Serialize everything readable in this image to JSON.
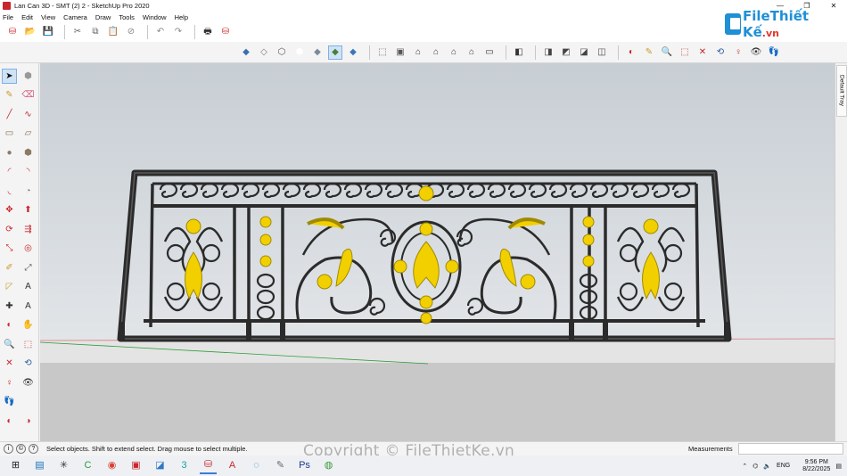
{
  "window": {
    "title": "Lan Can 3D - SMT (2) 2 - SketchUp Pro 2020",
    "min": "—",
    "max": "❐",
    "close": "✕"
  },
  "menu": [
    "File",
    "Edit",
    "View",
    "Camera",
    "Draw",
    "Tools",
    "Window",
    "Help"
  ],
  "toolbar1": [
    {
      "name": "get-models-icon",
      "glyph": "⛁",
      "color": "#c8262c"
    },
    {
      "name": "open-icon",
      "glyph": "📂",
      "color": "#c99a2e"
    },
    {
      "name": "save-icon",
      "glyph": "💾",
      "color": "#2c5d9b"
    },
    {
      "name": "cut-icon",
      "glyph": "✂",
      "color": "#666"
    },
    {
      "name": "copy-icon",
      "glyph": "⧉",
      "color": "#666"
    },
    {
      "name": "paste-icon",
      "glyph": "📋",
      "color": "#666"
    },
    {
      "name": "erase-icon",
      "glyph": "⊘",
      "color": "#888"
    },
    {
      "name": "undo-icon",
      "glyph": "↶",
      "color": "#888"
    },
    {
      "name": "redo-icon",
      "glyph": "↷",
      "color": "#888"
    },
    {
      "name": "print-icon",
      "glyph": "🖶",
      "color": "#333"
    },
    {
      "name": "extension-warehouse-icon",
      "glyph": "⛁",
      "color": "#c8262c"
    }
  ],
  "toolbar2": [
    {
      "name": "xray-icon",
      "glyph": "◆",
      "color": "#3a6fb0"
    },
    {
      "name": "back-edges-icon",
      "glyph": "◇",
      "color": "#777"
    },
    {
      "name": "wireframe-icon",
      "glyph": "⬡",
      "color": "#555"
    },
    {
      "name": "hidden-line-icon",
      "glyph": "⬢",
      "color": "#fff"
    },
    {
      "name": "shaded-icon",
      "glyph": "◆",
      "color": "#7a8a9a"
    },
    {
      "name": "shaded-textures-icon",
      "glyph": "◆",
      "color": "#4a7f3a",
      "active": true
    },
    {
      "name": "monochrome-icon",
      "glyph": "◆",
      "color": "#3b77b8"
    },
    {
      "name": "iso-view-icon",
      "glyph": "⬚",
      "color": "#555"
    },
    {
      "name": "top-view-icon",
      "glyph": "▣",
      "color": "#555"
    },
    {
      "name": "front-view-icon",
      "glyph": "⌂",
      "color": "#333"
    },
    {
      "name": "right-view-icon",
      "glyph": "⌂",
      "color": "#333"
    },
    {
      "name": "back-view-icon",
      "glyph": "⌂",
      "color": "#333"
    },
    {
      "name": "left-view-icon",
      "glyph": "⌂",
      "color": "#333"
    },
    {
      "name": "bottom-view-icon",
      "glyph": "▭",
      "color": "#333"
    },
    {
      "name": "camera-views-icon",
      "glyph": "◧",
      "color": "#333"
    },
    {
      "name": "style-1-icon",
      "glyph": "◨",
      "color": "#444"
    },
    {
      "name": "style-2-icon",
      "glyph": "◩",
      "color": "#444"
    },
    {
      "name": "style-3-icon",
      "glyph": "◪",
      "color": "#444"
    },
    {
      "name": "style-4-icon",
      "glyph": "◫",
      "color": "#444"
    },
    {
      "name": "section-plane-icon",
      "glyph": "◐",
      "color": "#c8262c"
    },
    {
      "name": "paint-bucket-icon",
      "glyph": "✎",
      "color": "#c99a2e"
    },
    {
      "name": "zoom-icon",
      "glyph": "🔍",
      "color": "#2c5d9b"
    },
    {
      "name": "zoom-window-icon",
      "glyph": "⬚",
      "color": "#c8262c"
    },
    {
      "name": "zoom-extents-icon",
      "glyph": "✕",
      "color": "#c8262c"
    },
    {
      "name": "previous-view-icon",
      "glyph": "⟲",
      "color": "#2c5d9b"
    },
    {
      "name": "position-camera-icon",
      "glyph": "♀",
      "color": "#c8262c"
    },
    {
      "name": "look-around-icon",
      "glyph": "👁",
      "color": "#333"
    },
    {
      "name": "walk-icon",
      "glyph": "👣",
      "color": "#333"
    }
  ],
  "left_tools": [
    [
      {
        "name": "select-icon",
        "glyph": "➤",
        "color": "#111",
        "active": true
      },
      {
        "name": "make-component-icon",
        "glyph": "⬢",
        "color": "#999"
      }
    ],
    [
      {
        "name": "paint-bucket-tool-icon",
        "glyph": "✎",
        "color": "#c99a2e"
      },
      {
        "name": "eraser-icon",
        "glyph": "⌫",
        "color": "#d8567a"
      }
    ],
    [
      {
        "name": "line-icon",
        "glyph": "╱",
        "color": "#c8262c"
      },
      {
        "name": "freehand-icon",
        "glyph": "∿",
        "color": "#c8262c"
      }
    ],
    [
      {
        "name": "rectangle-icon",
        "glyph": "▭",
        "color": "#8c6a4a"
      },
      {
        "name": "rotated-rectangle-icon",
        "glyph": "▱",
        "color": "#8c6a4a"
      }
    ],
    [
      {
        "name": "circle-icon",
        "glyph": "●",
        "color": "#8c7a66"
      },
      {
        "name": "polygon-icon",
        "glyph": "⬢",
        "color": "#8c7a66"
      }
    ],
    [
      {
        "name": "arc-icon",
        "glyph": "◜",
        "color": "#c8262c"
      },
      {
        "name": "two-point-arc-icon",
        "glyph": "◝",
        "color": "#c8262c"
      }
    ],
    [
      {
        "name": "three-point-arc-icon",
        "glyph": "◟",
        "color": "#c8262c"
      },
      {
        "name": "pie-icon",
        "glyph": "◔",
        "color": "#8c7a66"
      }
    ],
    [
      {
        "name": "move-icon",
        "glyph": "✥",
        "color": "#c8262c"
      },
      {
        "name": "push-pull-icon",
        "glyph": "⬆",
        "color": "#c8262c"
      }
    ],
    [
      {
        "name": "rotate-icon",
        "glyph": "⟳",
        "color": "#c8262c"
      },
      {
        "name": "follow-me-icon",
        "glyph": "⇶",
        "color": "#c8262c"
      }
    ],
    [
      {
        "name": "scale-icon",
        "glyph": "⤡",
        "color": "#c8262c"
      },
      {
        "name": "offset-icon",
        "glyph": "◎",
        "color": "#c8262c"
      }
    ],
    [
      {
        "name": "tape-measure-icon",
        "glyph": "✐",
        "color": "#c99a2e"
      },
      {
        "name": "dimension-icon",
        "glyph": "⤢",
        "color": "#555"
      }
    ],
    [
      {
        "name": "protractor-icon",
        "glyph": "◸",
        "color": "#c99a2e"
      },
      {
        "name": "text-icon",
        "glyph": "A",
        "color": "#333"
      }
    ],
    [
      {
        "name": "axes-icon",
        "glyph": "✚",
        "color": "#333"
      },
      {
        "name": "3d-text-icon",
        "glyph": "A",
        "color": "#333"
      }
    ],
    [
      {
        "name": "orbit-icon",
        "glyph": "◐",
        "color": "#c8262c"
      },
      {
        "name": "pan-icon",
        "glyph": "✋",
        "color": "#c99a2e"
      }
    ],
    [
      {
        "name": "zoom-tool-icon",
        "glyph": "🔍",
        "color": "#2c5d9b"
      },
      {
        "name": "zoom-window-tool-icon",
        "glyph": "⬚",
        "color": "#c8262c"
      }
    ],
    [
      {
        "name": "zoom-extents-tool-icon",
        "glyph": "✕",
        "color": "#c8262c"
      },
      {
        "name": "previous-tool-icon",
        "glyph": "⟲",
        "color": "#2c5d9b"
      }
    ],
    [
      {
        "name": "position-camera-tool-icon",
        "glyph": "♀",
        "color": "#c8262c"
      },
      {
        "name": "look-around-tool-icon",
        "glyph": "👁",
        "color": "#333"
      }
    ],
    [
      {
        "name": "walk-tool-icon",
        "glyph": "👣",
        "color": "#333"
      },
      {
        "name": "",
        "glyph": "",
        "color": "#333"
      }
    ],
    [
      {
        "name": "section-plane-tool-icon",
        "glyph": "◐",
        "color": "#c8262c"
      },
      {
        "name": "display-section-icon",
        "glyph": "◑",
        "color": "#c8262c"
      }
    ]
  ],
  "viewport": {
    "sky_top": "#c9cfd5",
    "sky_bottom": "#dee2e6",
    "ground": "#c8c8c8",
    "ground_line": "#bfbfbf",
    "frame_color": "#2b2b2b",
    "frame_light": "#5a5a5a",
    "gold": "#f2d000",
    "gold_dark": "#a08a00"
  },
  "tray": {
    "tab": "Default Tray"
  },
  "status": {
    "hint": "Select objects. Shift to extend select. Drag mouse to select multiple.",
    "measurements_label": "Measurements",
    "measurements_value": ""
  },
  "watermark": "Copyright © FileThietKe.vn",
  "logo": {
    "text_main": "File",
    "text_accent": "Thiết Kế",
    "suffix": ".vn"
  },
  "taskbar": {
    "apps": [
      {
        "name": "windows-start-icon",
        "glyph": "⊞",
        "color": "#222"
      },
      {
        "name": "file-manager-icon",
        "glyph": "▤",
        "color": "#1f6fb5"
      },
      {
        "name": "network-app-icon",
        "glyph": "✳",
        "color": "#333"
      },
      {
        "name": "camtasia-icon",
        "glyph": "C",
        "color": "#2e9b3a"
      },
      {
        "name": "chrome-icon",
        "glyph": "◉",
        "color": "#d9432f"
      },
      {
        "name": "autocad-icon",
        "glyph": "▣",
        "color": "#c8262c"
      },
      {
        "name": "app-icon-6",
        "glyph": "◪",
        "color": "#2f78c4"
      },
      {
        "name": "3dsmax-icon",
        "glyph": "3",
        "color": "#1aa39a"
      },
      {
        "name": "sketchup-icon",
        "glyph": "⛁",
        "color": "#c8262c",
        "active": true
      },
      {
        "name": "acrobat-icon",
        "glyph": "A",
        "color": "#c8262c"
      },
      {
        "name": "edge-icon",
        "glyph": "◌",
        "color": "#1e88c7"
      },
      {
        "name": "tool-app-icon",
        "glyph": "✎",
        "color": "#666"
      },
      {
        "name": "photoshop-icon",
        "glyph": "Ps",
        "color": "#1b3a8a"
      },
      {
        "name": "green-app-icon",
        "glyph": "◍",
        "color": "#3a9a3a"
      }
    ],
    "tray": {
      "chevron": "⌃",
      "lang": "ENG",
      "time": "9:56 PM",
      "date": "8/22/2025"
    }
  }
}
